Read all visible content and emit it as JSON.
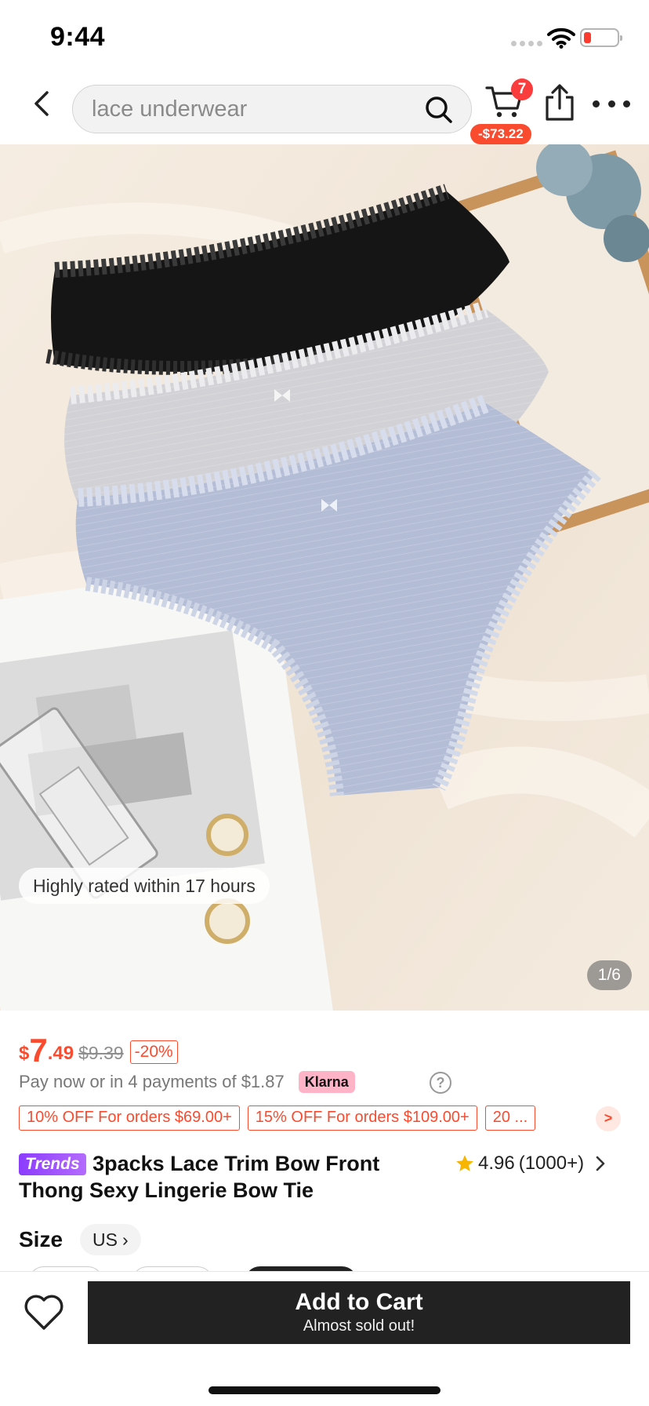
{
  "status_bar": {
    "time": "9:44"
  },
  "header": {
    "search_placeholder": "lace underwear",
    "cart_count": "7",
    "cart_savings": "-$73.22"
  },
  "hero": {
    "rated_label": "Highly rated within 17 hours",
    "image_counter": "1/6"
  },
  "product": {
    "price_currency": "$",
    "price_integer": "7",
    "price_decimal": ".49",
    "original_price": "$9.39",
    "discount": "-20%",
    "installments_text": "Pay now or in 4 payments of $1.87",
    "klarna_label": "Klarna",
    "help_icon": "?",
    "promos": [
      "10% OFF For orders $69.00+",
      "15% OFF For orders $109.00+",
      "20 ..."
    ],
    "trends_badge": "Trends",
    "title": "3packs Lace Trim Bow Front Thong Sexy Lingerie Bow Tie",
    "rating_value": "4.96",
    "rating_count": "(1000+)",
    "size_label": "Size",
    "size_region": "US",
    "size_region_chevron": "›"
  },
  "bottom_bar": {
    "add_to_cart_label": "Add to Cart",
    "add_to_cart_sub": "Almost sold out!"
  },
  "icons": {
    "back": "chevron-left-icon",
    "search": "search-icon",
    "cart": "cart-icon",
    "share": "share-icon",
    "more": "more-icon",
    "star": "star-icon",
    "wishlist": "heart-icon",
    "promo_more": "chevron-right-icon"
  },
  "colors": {
    "accent": "#fa4b2f",
    "cart_badge": "#fa3c3c",
    "klarna": "#ffb3c7",
    "trends_badge": "#8b3cff",
    "star": "#f7b500",
    "primary_button": "#222222"
  }
}
